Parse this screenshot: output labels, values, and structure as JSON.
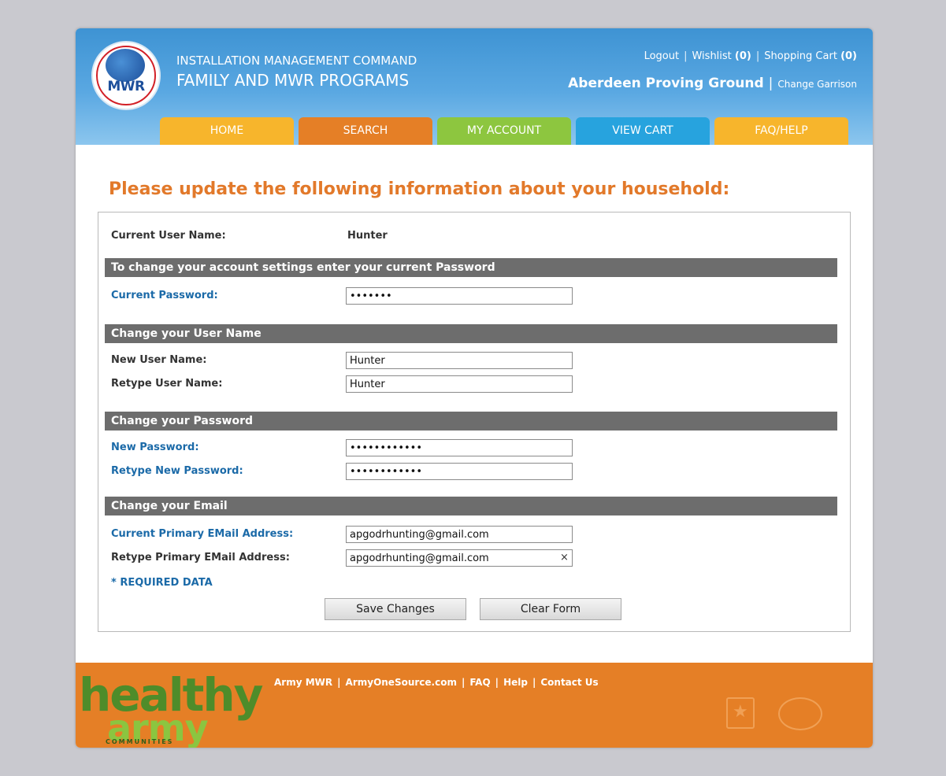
{
  "header": {
    "org_line1": "INSTALLATION MANAGEMENT COMMAND",
    "org_line2": "FAMILY AND MWR PROGRAMS",
    "logo_text": "MWR",
    "links": {
      "logout": "Logout",
      "wishlist_label": "Wishlist",
      "wishlist_count": "(0)",
      "cart_label": "Shopping Cart",
      "cart_count": "(0)"
    },
    "garrison_name": "Aberdeen Proving Ground",
    "change_garrison": "Change Garrison"
  },
  "nav": {
    "tabs": [
      {
        "label": "HOME",
        "color": "#f7b52c"
      },
      {
        "label": "SEARCH",
        "color": "#e57f26"
      },
      {
        "label": "MY ACCOUNT",
        "color": "#8dc63f"
      },
      {
        "label": "VIEW CART",
        "color": "#27a3de"
      },
      {
        "label": "FAQ/HELP",
        "color": "#f7b52c"
      }
    ]
  },
  "page": {
    "title": "Please update the following information about your household:"
  },
  "form": {
    "current_user_label": "Current User Name:",
    "current_user_value": "Hunter",
    "sections": {
      "account": "To change your account settings enter your current Password",
      "username": "Change your User Name",
      "password": "Change your Password",
      "email": "Change your Email"
    },
    "fields": {
      "current_password": {
        "label": "Current Password:",
        "value": "•••••••"
      },
      "new_username": {
        "label": "New User Name:",
        "value": "Hunter"
      },
      "retype_username": {
        "label": "Retype User Name:",
        "value": "Hunter"
      },
      "new_password": {
        "label": "New Password:",
        "value": "••••••••••••"
      },
      "retype_password": {
        "label": "Retype New Password:",
        "value": "••••••••••••"
      },
      "primary_email": {
        "label": "Current Primary EMail Address:",
        "value": "apgodrhunting@gmail.com"
      },
      "retype_email": {
        "label": "Retype Primary EMail Address:",
        "value": "apgodrhunting@gmail.com"
      }
    },
    "clear_glyph": "×",
    "required_note": "* REQUIRED DATA",
    "save_label": "Save Changes",
    "clear_label": "Clear Form"
  },
  "footer": {
    "brand_word1": "healthy",
    "brand_word2": "army",
    "brand_word3": "COMMUNITIES",
    "links": [
      "Army MWR",
      "ArmyOneSource.com",
      "FAQ",
      "Help",
      "Contact Us"
    ],
    "separator": "|"
  },
  "colors": {
    "accent_orange": "#e2792a",
    "required_blue": "#1b6aa8",
    "section_bar": "#6d6d6d"
  }
}
